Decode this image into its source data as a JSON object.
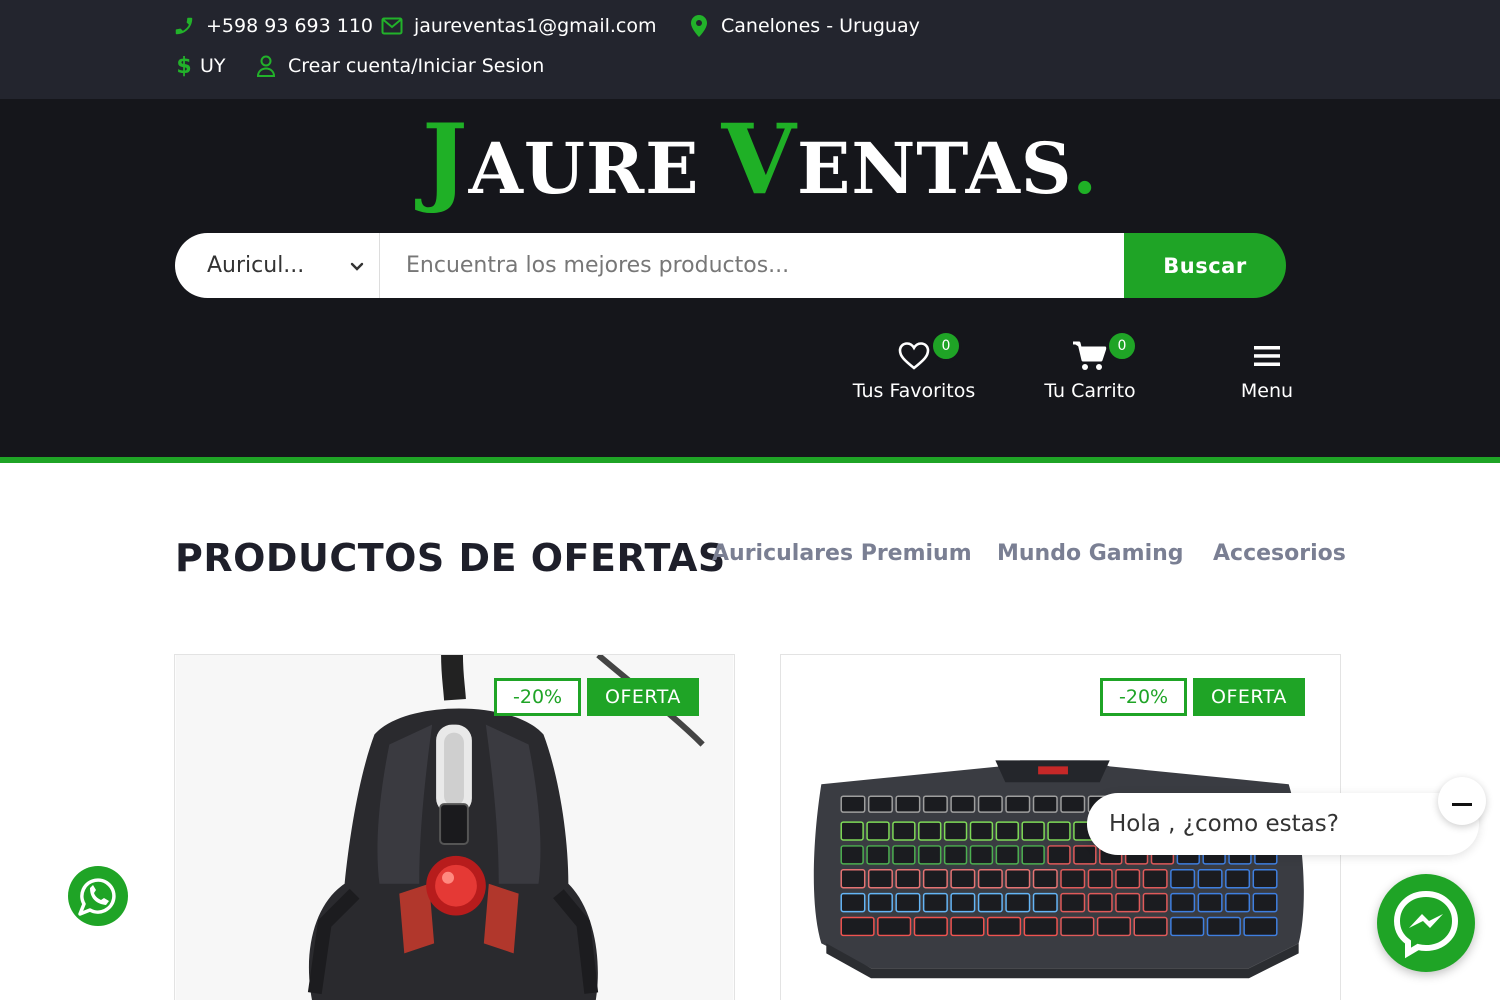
{
  "topbar": {
    "phone": "+598 93 693 110",
    "email": "jaureventas1@gmail.com",
    "location": "Canelones - Uruguay",
    "currency_symbol": "$",
    "currency": "UY",
    "account": "Crear cuenta/Iniciar Sesion"
  },
  "logo": {
    "j": "J",
    "word1": "AURE",
    "v": "V",
    "word2": "ENTAS",
    "dot": "."
  },
  "search": {
    "category": "Auricul...",
    "placeholder": "Encuentra los mejores productos...",
    "button": "Buscar"
  },
  "header_actions": {
    "favorites_label": "Tus Favoritos",
    "favorites_count": "0",
    "cart_label": "Tu Carrito",
    "cart_count": "0",
    "menu_label": "Menu"
  },
  "section": {
    "title": "PRODUCTOS DE OFERTAS",
    "tabs": [
      "Auriculares Premium",
      "Mundo Gaming",
      "Accesorios"
    ]
  },
  "products": [
    {
      "discount": "-20%",
      "badge": "OFERTA",
      "image": "gaming-mouse"
    },
    {
      "discount": "-20%",
      "badge": "OFERTA",
      "image": "gaming-keyboard"
    }
  ],
  "chat": {
    "greeting": "Hola , ¿como estas?"
  },
  "colors": {
    "accent": "#1fa426",
    "topbar_bg": "#23252e",
    "header_bg": "#15161b"
  }
}
